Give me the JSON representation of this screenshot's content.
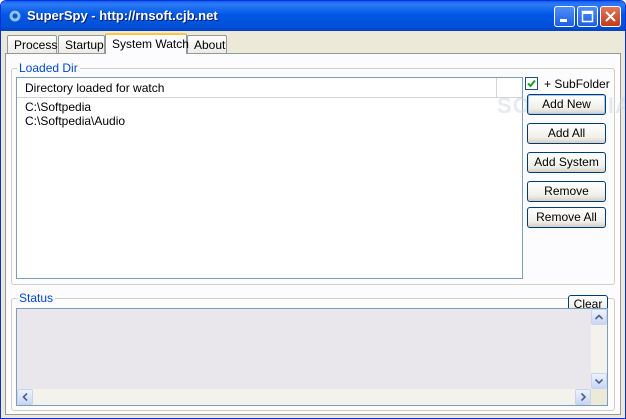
{
  "window": {
    "title": "SuperSpy - http://rnsoft.cjb.net"
  },
  "tabs": [
    {
      "label": "Process"
    },
    {
      "label": "Startup"
    },
    {
      "label": "System Watch"
    },
    {
      "label": "About"
    }
  ],
  "active_tab": "System Watch",
  "loaded_dir": {
    "group_label": "Loaded Dir",
    "list_header": "Directory loaded for watch",
    "rows": [
      "C:\\Softpedia",
      "C:\\Softpedia\\Audio"
    ],
    "subfolder_label": "+ SubFolder",
    "subfolder_checked": true
  },
  "buttons": {
    "add_new": "Add New",
    "add_all": "Add All",
    "add_system": "Add System",
    "remove": "Remove",
    "remove_all": "Remove All"
  },
  "status": {
    "group_label": "Status",
    "clear_label": "Clear"
  },
  "watermark": "SOFTPEDIA",
  "colors": {
    "titlebar": "#0058e6",
    "group_label": "#0046d5",
    "checkbox_mark": "#21a121"
  }
}
